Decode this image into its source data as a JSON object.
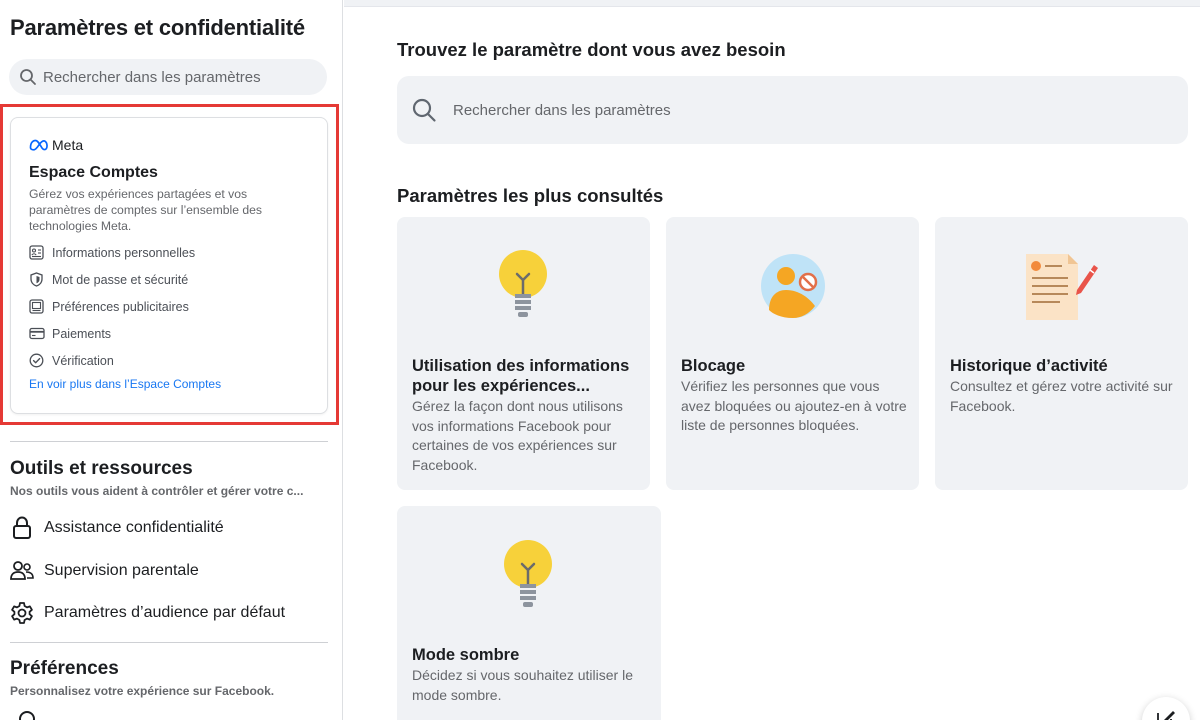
{
  "sidebar": {
    "title": "Paramètres et confidentialité",
    "search_placeholder": "Rechercher dans les paramètres",
    "accounts_center": {
      "brand": "Meta",
      "title": "Espace Comptes",
      "description": "Gérez vos expériences partagées et vos paramètres de comptes sur l’ensemble des technologies Meta.",
      "items": [
        {
          "label": "Informations personnelles",
          "icon": "id-card-icon"
        },
        {
          "label": "Mot de passe et sécurité",
          "icon": "shield-icon"
        },
        {
          "label": "Préférences publicitaires",
          "icon": "ad-monitor-icon"
        },
        {
          "label": "Paiements",
          "icon": "credit-card-icon"
        },
        {
          "label": "Vérification",
          "icon": "check-badge-icon"
        }
      ],
      "more_link": "En voir plus dans l’Espace Comptes",
      "highlight_color": "#e53935"
    },
    "tools": {
      "title": "Outils et ressources",
      "subtitle": "Nos outils vous aident à contrôler et gérer votre c...",
      "items": [
        {
          "label": "Assistance confidentialité",
          "icon": "lock-icon"
        },
        {
          "label": "Supervision parentale",
          "icon": "people-icon"
        },
        {
          "label": "Paramètres d’audience par défaut",
          "icon": "gear-icon"
        }
      ]
    },
    "preferences": {
      "title": "Préférences",
      "subtitle": "Personnalisez votre expérience sur Facebook."
    }
  },
  "main": {
    "title": "Trouvez le paramètre dont vous avez besoin",
    "search_placeholder": "Rechercher dans les paramètres",
    "most_viewed_title": "Paramètres les plus consultés",
    "tiles": [
      {
        "title": "Utilisation des informations pour les expériences...",
        "description": "Gérez la façon dont nous utilisons vos informations Facebook pour certaines de vos expériences sur Facebook.",
        "icon": "lightbulb-icon"
      },
      {
        "title": "Blocage",
        "description": "Vérifiez les personnes que vous avez bloquées ou ajoutez-en à votre liste de personnes bloquées.",
        "icon": "blocked-person-icon"
      },
      {
        "title": "Historique d’activité",
        "description": "Consultez et gérez votre activité sur Facebook.",
        "icon": "activity-log-icon"
      },
      {
        "title": "Mode sombre",
        "description": "Décidez si vous souhaitez utiliser le mode sombre.",
        "icon": "lightbulb-icon"
      }
    ]
  },
  "colors": {
    "link": "#1877f2",
    "tile_bg": "#f0f2f5",
    "bulb": "#f7d13a",
    "accent_orange": "#f5a623"
  }
}
